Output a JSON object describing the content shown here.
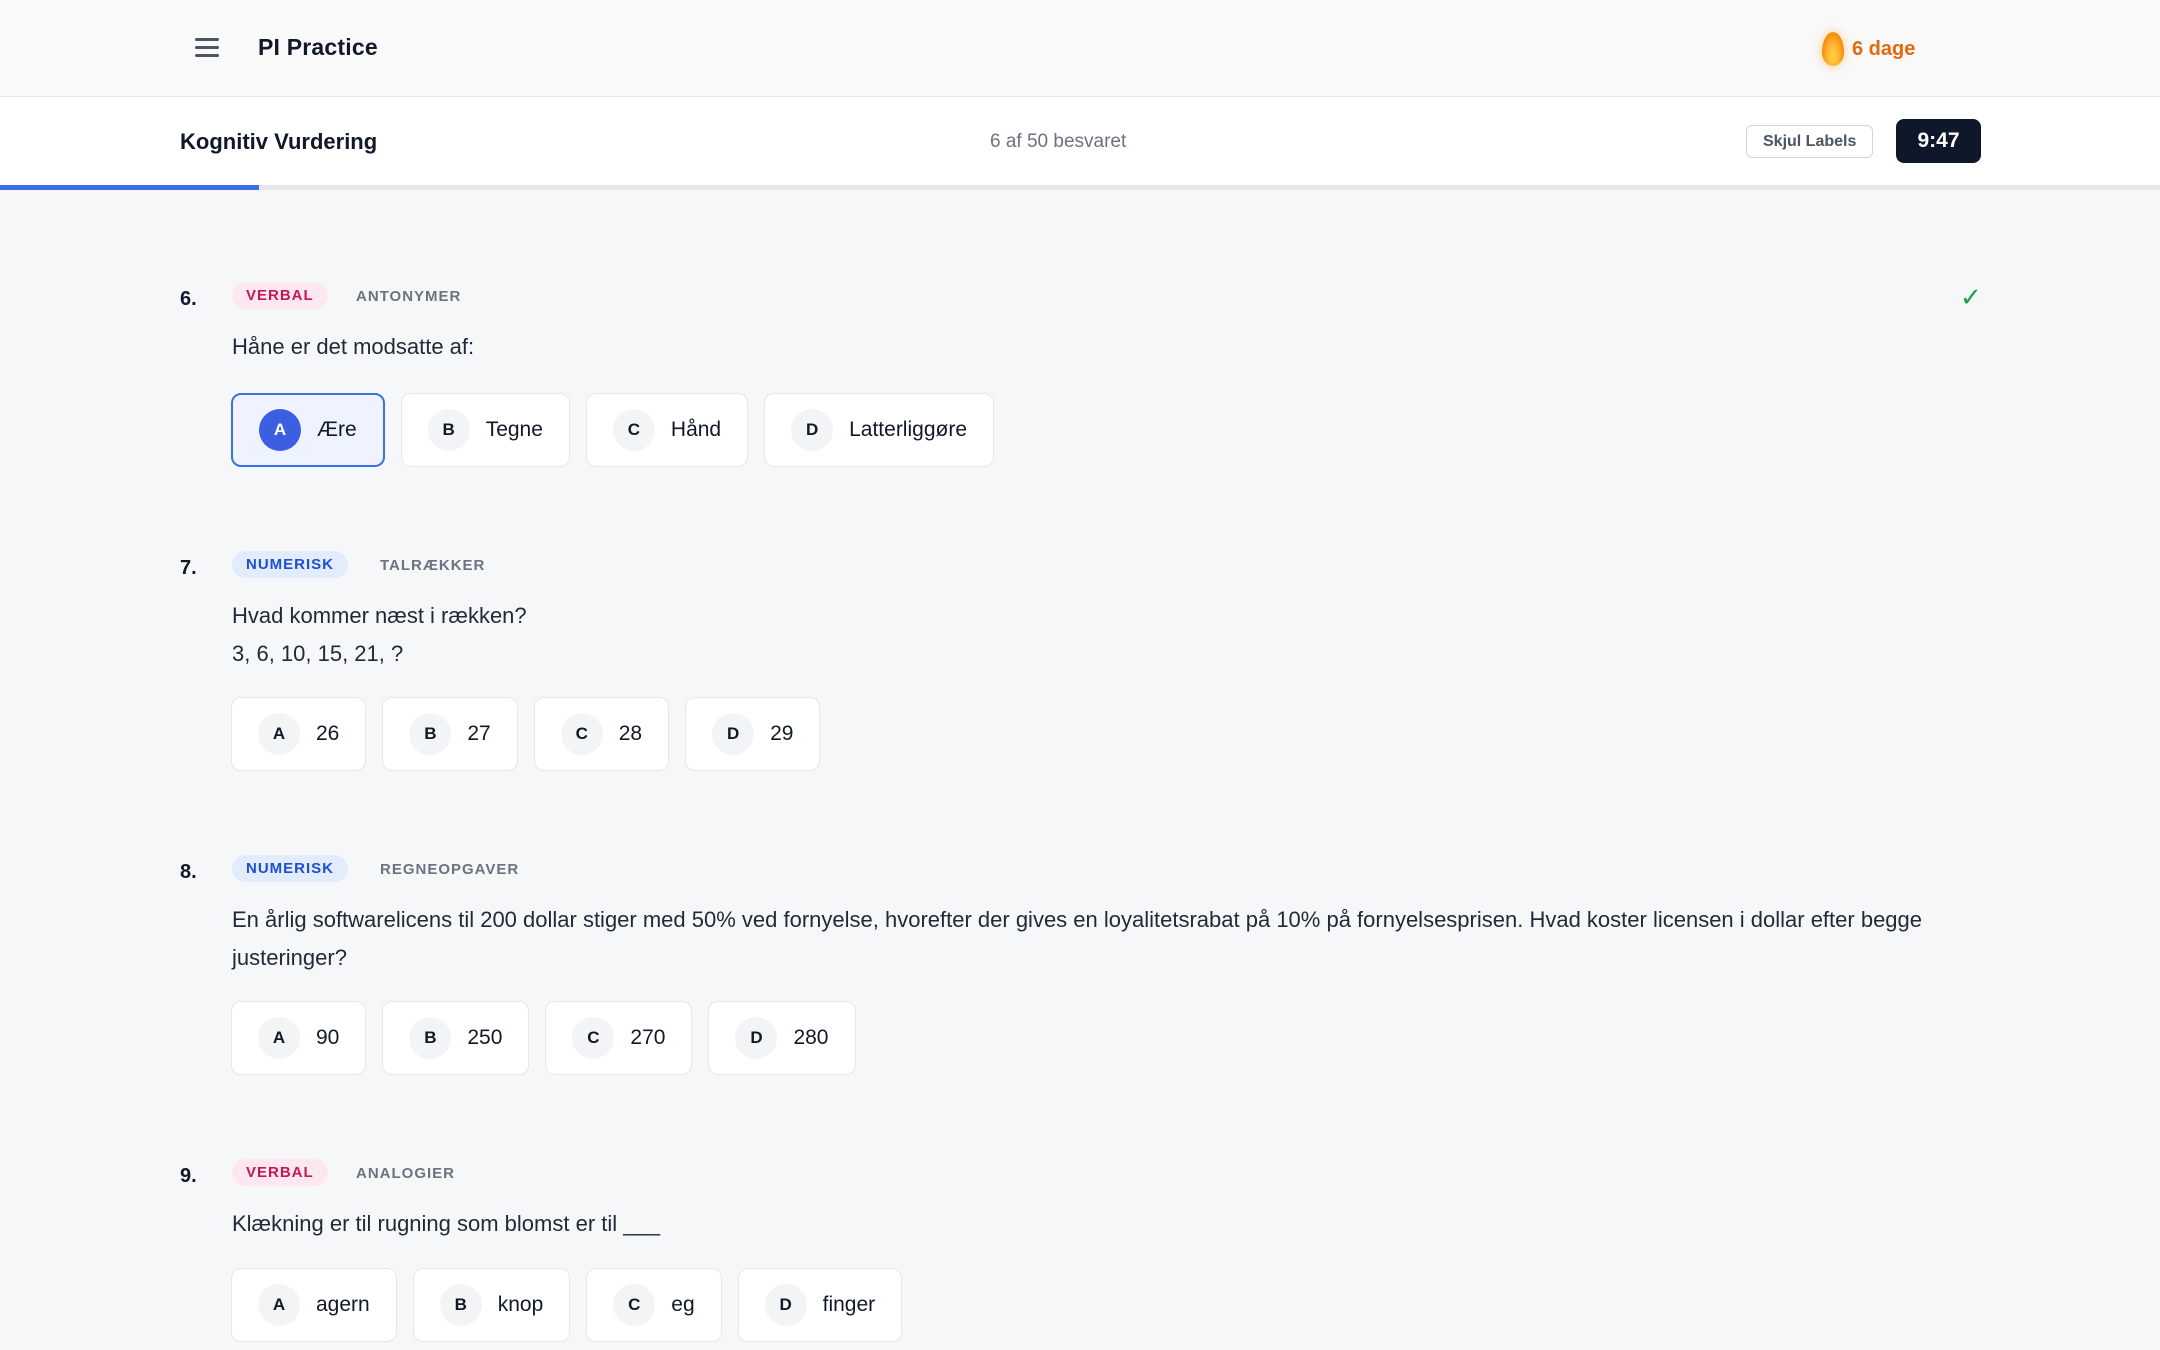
{
  "app": {
    "title": "PI Practice",
    "menu_icon": "hamburger-menu-icon",
    "streak": {
      "icon": "flame-icon",
      "label": "6 dage"
    }
  },
  "assessment": {
    "title": "Kognitiv Vurdering",
    "answered": "6 af 50 besvaret",
    "hide_labels": "Skjul Labels",
    "timer": "9:47",
    "progress_fraction": 0.12
  },
  "colors": {
    "accent": "#3b6fe6",
    "verbal_badge": "#c2185b",
    "numeric_badge": "#1d4ed8",
    "streak": "#e2690f",
    "check": "#16a34a"
  },
  "questions": [
    {
      "number": "6.",
      "category": "VERBAL",
      "subcategory": "ANTONYMER",
      "text": "Håne er det modsatte af:",
      "answered": true,
      "check_icon": "checkmark-icon",
      "options": [
        {
          "letter": "A",
          "label": "Ære",
          "selected": true
        },
        {
          "letter": "B",
          "label": "Tegne"
        },
        {
          "letter": "C",
          "label": "Hånd"
        },
        {
          "letter": "D",
          "label": "Latterliggøre"
        }
      ]
    },
    {
      "number": "7.",
      "category": "NUMERISK",
      "subcategory": "TALRÆKKER",
      "text": "Hvad kommer næst i rækken?",
      "text2": "3, 6, 10, 15, 21, ?",
      "options": [
        {
          "letter": "A",
          "label": "26"
        },
        {
          "letter": "B",
          "label": "27"
        },
        {
          "letter": "C",
          "label": "28"
        },
        {
          "letter": "D",
          "label": "29"
        }
      ]
    },
    {
      "number": "8.",
      "category": "NUMERISK",
      "subcategory": "REGNEOPGAVER",
      "text": "En årlig softwarelicens til 200 dollar stiger med 50% ved fornyelse, hvorefter der gives en loyalitetsrabat på 10% på fornyelsesprisen. Hvad koster licensen i dollar efter begge justeringer?",
      "options": [
        {
          "letter": "A",
          "label": "90"
        },
        {
          "letter": "B",
          "label": "250"
        },
        {
          "letter": "C",
          "label": "270"
        },
        {
          "letter": "D",
          "label": "280"
        }
      ]
    },
    {
      "number": "9.",
      "category": "VERBAL",
      "subcategory": "ANALOGIER",
      "text": "Klækning er til rugning som blomst er til ___",
      "options": [
        {
          "letter": "A",
          "label": "agern"
        },
        {
          "letter": "B",
          "label": "knop"
        },
        {
          "letter": "C",
          "label": "eg"
        },
        {
          "letter": "D",
          "label": "finger"
        }
      ]
    }
  ]
}
